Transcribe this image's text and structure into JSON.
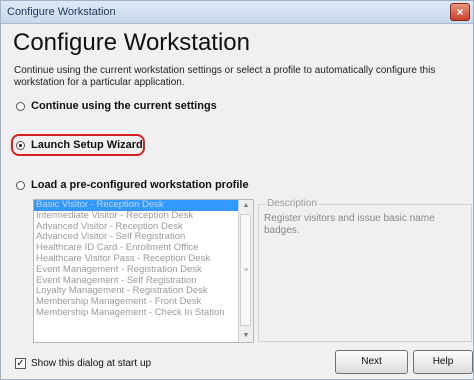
{
  "window": {
    "title": "Configure Workstation",
    "close_glyph": "×"
  },
  "heading": "Configure Workstation",
  "description": "Continue using the current workstation settings or select a profile to automatically configure this workstation for a particular application.",
  "options": {
    "continue_label": "Continue using the current settings",
    "wizard_label": "Launch Setup Wizard",
    "profile_label": "Load a pre-configured workstation profile",
    "selected": "wizard"
  },
  "profiles": [
    "Basic Visitor - Reception Desk",
    "Intermediate Visitor - Reception Desk",
    "Advanced Visitor - Reception Desk",
    "Advanced Visitor - Self Registration",
    "Healthcare ID Card - Enrollment Office",
    "Healthcare Visitor Pass - Reception Desk",
    "Event Management - Registration Desk",
    "Event Management - Self Registration",
    "Loyalty Management - Registration Desk",
    "Membership Management - Front Desk",
    "Membership Management - Check In Station"
  ],
  "description_panel": {
    "legend": "Description",
    "text": "Register visitors and issue basic name badges."
  },
  "show_at_startup": {
    "label": "Show this dialog at start up",
    "checked": true
  },
  "buttons": {
    "next": "Next",
    "help": "Help"
  },
  "colors": {
    "selection": "#3399ff",
    "highlight_ring": "#d72020"
  }
}
